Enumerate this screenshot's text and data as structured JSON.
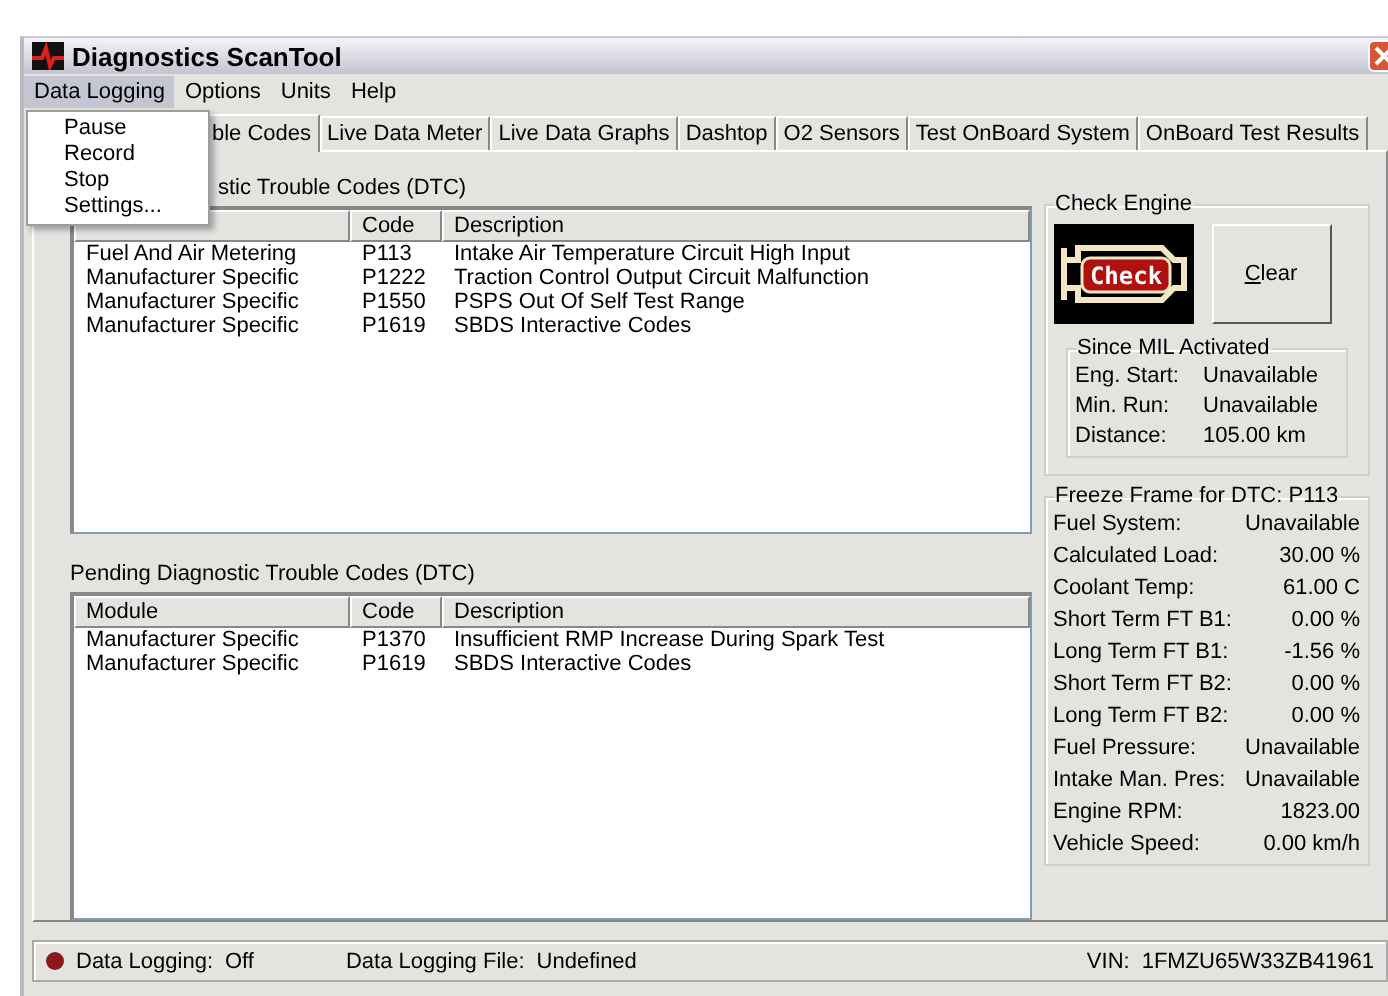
{
  "window": {
    "title": "Diagnostics ScanTool"
  },
  "menu": [
    {
      "label": "Data Logging",
      "selected": true
    },
    {
      "label": "Options",
      "selected": false
    },
    {
      "label": "Units",
      "selected": false
    },
    {
      "label": "Help",
      "selected": false
    }
  ],
  "open_menu": {
    "items": [
      "Pause",
      "Record",
      "Stop",
      "Settings..."
    ]
  },
  "tabs": [
    {
      "label": "ble Codes",
      "selected": true
    },
    {
      "label": "Live Data Meter",
      "selected": false
    },
    {
      "label": "Live Data Graphs",
      "selected": false
    },
    {
      "label": "Dashtop",
      "selected": false
    },
    {
      "label": "O2 Sensors",
      "selected": false
    },
    {
      "label": "Test OnBoard System",
      "selected": false
    },
    {
      "label": "OnBoard Test Results",
      "selected": false
    }
  ],
  "stored_codes": {
    "title": "stic Trouble Codes (DTC)",
    "columns": [
      "Code",
      "Description"
    ],
    "rows": [
      {
        "module": "Fuel And Air Metering",
        "code": "P113",
        "description": "Intake Air Temperature Circuit High Input"
      },
      {
        "module": "Manufacturer Specific",
        "code": "P1222",
        "description": "Traction Control Output Circuit Malfunction"
      },
      {
        "module": "Manufacturer Specific",
        "code": "P1550",
        "description": "PSPS Out Of Self Test Range"
      },
      {
        "module": "Manufacturer Specific",
        "code": "P1619",
        "description": "SBDS Interactive Codes"
      }
    ]
  },
  "pending_codes": {
    "title": "Pending Diagnostic Trouble Codes (DTC)",
    "columns": [
      "Module",
      "Code",
      "Description"
    ],
    "rows": [
      {
        "module": "Manufacturer Specific",
        "code": "P1370",
        "description": "Insufficient RMP Increase During Spark Test"
      },
      {
        "module": "Manufacturer Specific",
        "code": "P1619",
        "description": "SBDS Interactive Codes"
      }
    ]
  },
  "check_engine": {
    "title": "Check Engine",
    "lamp_text": "Check",
    "clear_button": "Clear",
    "since_mil": {
      "title": "Since MIL Activated",
      "rows": [
        {
          "label": "Eng. Start:",
          "value": "Unavailable"
        },
        {
          "label": "Min. Run:",
          "value": "Unavailable"
        },
        {
          "label": "Distance:",
          "value": "105.00 km"
        }
      ]
    }
  },
  "freeze_frame": {
    "title": "Freeze Frame for DTC: P113",
    "rows": [
      {
        "label": "Fuel System:",
        "value": "Unavailable"
      },
      {
        "label": "Calculated Load:",
        "value": "30.00 %"
      },
      {
        "label": "Coolant Temp:",
        "value": "61.00 C"
      },
      {
        "label": "Short Term FT B1:",
        "value": "0.00 %"
      },
      {
        "label": "Long Term FT B1:",
        "value": "-1.56 %"
      },
      {
        "label": "Short Term FT B2:",
        "value": "0.00 %"
      },
      {
        "label": "Long Term FT B2:",
        "value": "0.00 %"
      },
      {
        "label": "Fuel Pressure:",
        "value": "Unavailable"
      },
      {
        "label": "Intake Man. Pres:",
        "value": "Unavailable"
      },
      {
        "label": "Engine RPM:",
        "value": "1823.00"
      },
      {
        "label": "Vehicle Speed:",
        "value": "0.00 km/h"
      }
    ]
  },
  "status_bar": {
    "logging_on": false,
    "logging_label": "Data Logging:",
    "logging_value": "Off",
    "file_label": "Data Logging File:",
    "file_value": "Undefined",
    "vin_label": "VIN:",
    "vin_value": "1FMZU65W33ZB41961"
  }
}
